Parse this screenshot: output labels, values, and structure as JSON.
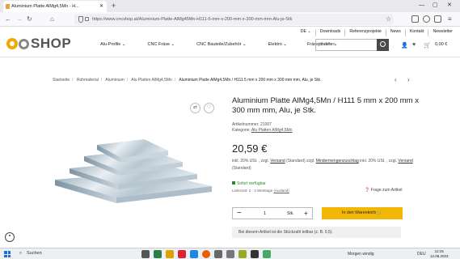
{
  "browser": {
    "tab_title": "Aluminium Platte AlMg4,5Mn - H...",
    "url": "https://www.cncshop.at/Aluminium-Platte-AlMg45Mn-H111-5-mm-x-200-mm-x-300-mm-mm-Alu-je-Stk"
  },
  "toplinks": {
    "lang": "DE ⌄",
    "downloads": "Downloads",
    "references": "Referenzprojekte",
    "news": "News",
    "contact": "Kontakt",
    "newsletter": "Newsletter"
  },
  "logo": {
    "text": "SHOP"
  },
  "nav": [
    "Alu-Profile ⌄",
    "CNC Fräse ⌄",
    "CNC Bauteile/Zubehör ⌄",
    "Elektro ⌄",
    "Frässpindeln ⌄"
  ],
  "search": {
    "placeholder": "Suchen"
  },
  "cart_total": "0,00 €",
  "breadcrumb": [
    "Startseite",
    "Rohmaterial",
    "Aluminium",
    "Alu Platten AlMg4,5Mn",
    "Aluminium Platte AlMg4,5Mn / H111 5 mm x 200 mm x 300 mm mm, Alu, je Stk."
  ],
  "product": {
    "title": "Aluminium Platte AlMg4,5Mn / H111 5 mm x 200 mm x 300 mm mm, Alu, je Stk.",
    "article_no": "Artikelnummer: 21007",
    "category_label": "Kategorie:",
    "category": "Alu Platten AlMg4,5Mn",
    "price": "20,59 €",
    "vat_line1": "inkl. 20% USt. , zzgl.",
    "vat_link1": "Versand",
    "vat_mid": "(Standard) zzgl.",
    "vat_link2": "Mindermengenzuschlag",
    "vat_end": "inkl. 20% USt. , zzgl.",
    "vat_link3": "Versand",
    "vat_tail": "(Standard)",
    "availability": "Sofort verfügbar",
    "delivery": "Lieferzeit: 2 - 3 Werktage",
    "delivery_link": "(Ausland)",
    "ask": "Frage zum Artikel",
    "qty": "1",
    "unit": "Stk.",
    "add_to_cart": "In den Warenkorb",
    "note": "Bei diesem Artikel ist die Stückzahl teilbar (z. B. 0,5)."
  },
  "taskbar": {
    "search": "Suchen",
    "weather": "Morgen windig",
    "lang": "DEU",
    "time": "12:25",
    "date": "12.08.2023"
  }
}
